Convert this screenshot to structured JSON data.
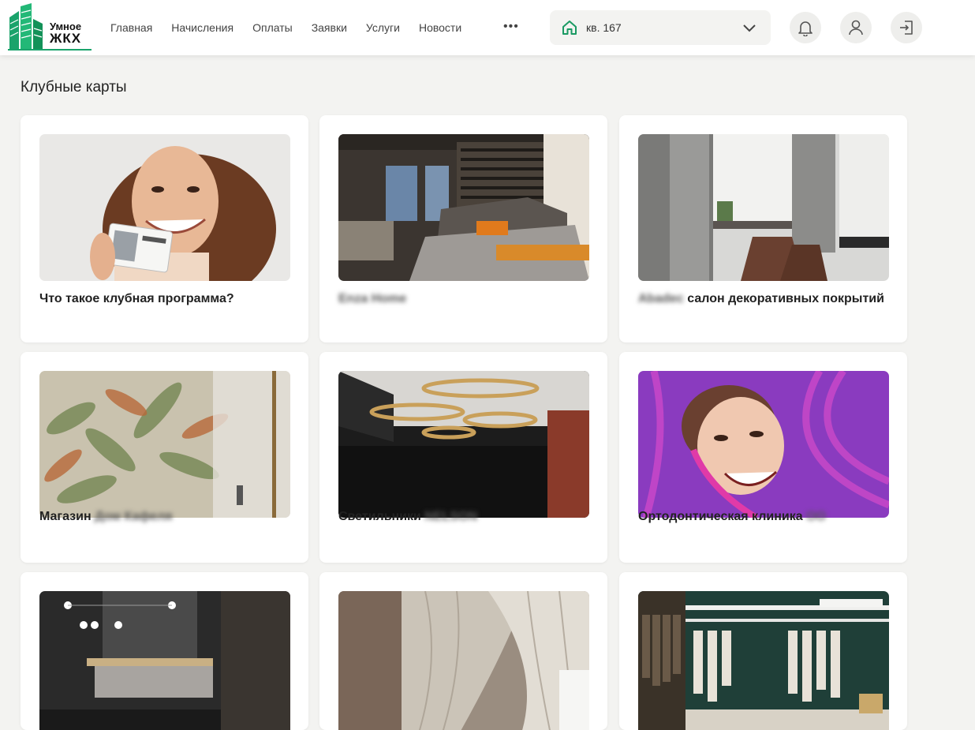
{
  "header": {
    "logo": {
      "line1": "Умное",
      "line2": "ЖКХ"
    },
    "nav": [
      {
        "label": "Главная"
      },
      {
        "label": "Начисления"
      },
      {
        "label": "Оплаты"
      },
      {
        "label": "Заявки"
      },
      {
        "label": "Услуги"
      },
      {
        "label": "Новости"
      }
    ],
    "more_label": "•••",
    "apartment": {
      "label": "кв. 167",
      "icon": "home-icon"
    },
    "icons": [
      "bell-icon",
      "user-icon",
      "logout-icon"
    ]
  },
  "page": {
    "title": "Клубные карты"
  },
  "cards": [
    {
      "title": "Что такое клубная программа?",
      "blurred": ""
    },
    {
      "title": "",
      "blurred": "Enza Home"
    },
    {
      "title": "салон декоративных покрытий",
      "blurred": "Abadec"
    },
    {
      "title": "Магазин",
      "blurred": "Дом Кафеля"
    },
    {
      "title": "Светильники",
      "blurred": "NELSON"
    },
    {
      "title": "Ортодонтическая клиника",
      "blurred": "ОО"
    },
    {
      "title": "",
      "blurred": ""
    },
    {
      "title": "",
      "blurred": ""
    },
    {
      "title": "",
      "blurred": ""
    }
  ],
  "colors": {
    "brand": "#1aa36b",
    "background": "#f3f3f1",
    "card": "#ffffff"
  }
}
